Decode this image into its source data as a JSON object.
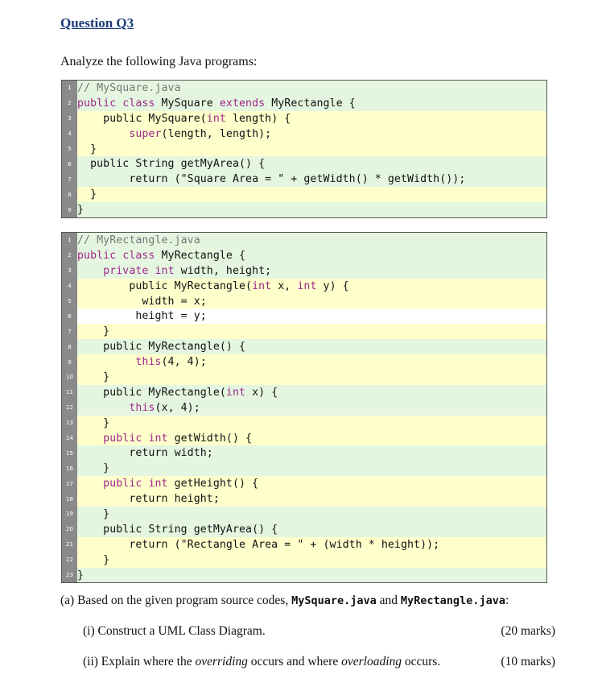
{
  "heading": "Question Q3",
  "intro": "Analyze the following Java programs:",
  "code_blocks": [
    {
      "name": "MySquare",
      "lines": [
        {
          "n": "1",
          "parts": [
            {
              "t": "// MySquare.java",
              "c": "comment"
            }
          ]
        },
        {
          "n": "2",
          "parts": [
            {
              "t": "public class ",
              "c": "kw"
            },
            {
              "t": "MySquare ",
              "c": ""
            },
            {
              "t": "extends ",
              "c": "kw"
            },
            {
              "t": "MyRectangle {",
              "c": ""
            }
          ]
        },
        {
          "n": "3",
          "parts": [
            {
              "t": "    public MySquare(",
              "c": ""
            },
            {
              "t": "int",
              "c": "kw"
            },
            {
              "t": " length) {",
              "c": ""
            }
          ]
        },
        {
          "n": "4",
          "parts": [
            {
              "t": "        super",
              "c": "kw"
            },
            {
              "t": "(length, length);",
              "c": ""
            }
          ]
        },
        {
          "n": "5",
          "parts": [
            {
              "t": "  }",
              "c": ""
            }
          ]
        },
        {
          "n": "6",
          "parts": [
            {
              "t": "  public String getMyArea() {",
              "c": ""
            }
          ]
        },
        {
          "n": "7",
          "parts": [
            {
              "t": "        return (\"Square Area = \" + getWidth() * getWidth());",
              "c": ""
            }
          ]
        },
        {
          "n": "8",
          "parts": [
            {
              "t": "  }",
              "c": ""
            }
          ]
        },
        {
          "n": "9",
          "parts": [
            {
              "t": "}",
              "c": ""
            }
          ]
        }
      ]
    },
    {
      "name": "MyRectangle",
      "lines": [
        {
          "n": "1",
          "parts": [
            {
              "t": "// MyRectangle.java",
              "c": "comment"
            }
          ]
        },
        {
          "n": "2",
          "parts": [
            {
              "t": "public class ",
              "c": "kw"
            },
            {
              "t": "MyRectangle {",
              "c": ""
            }
          ]
        },
        {
          "n": "3",
          "parts": [
            {
              "t": "    private ",
              "c": "kw"
            },
            {
              "t": "int",
              "c": "kw"
            },
            {
              "t": " width, height;",
              "c": ""
            }
          ]
        },
        {
          "n": "4",
          "parts": [
            {
              "t": "        public MyRectangle(",
              "c": ""
            },
            {
              "t": "int",
              "c": "kw"
            },
            {
              "t": " x, ",
              "c": ""
            },
            {
              "t": "int",
              "c": "kw"
            },
            {
              "t": " y) {",
              "c": ""
            }
          ]
        },
        {
          "n": "5",
          "parts": [
            {
              "t": "          width = x;",
              "c": ""
            }
          ]
        },
        {
          "n": "6",
          "parts": [
            {
              "t": "         height = y;",
              "c": ""
            }
          ]
        },
        {
          "n": "7",
          "parts": [
            {
              "t": "    }",
              "c": ""
            }
          ]
        },
        {
          "n": "8",
          "parts": [
            {
              "t": "    public MyRectangle() {",
              "c": ""
            }
          ]
        },
        {
          "n": "9",
          "parts": [
            {
              "t": "         this",
              "c": "kw"
            },
            {
              "t": "(4, 4);",
              "c": ""
            }
          ]
        },
        {
          "n": "10",
          "parts": [
            {
              "t": "    }",
              "c": ""
            }
          ]
        },
        {
          "n": "11",
          "parts": [
            {
              "t": "    public MyRectangle(",
              "c": ""
            },
            {
              "t": "int",
              "c": "kw"
            },
            {
              "t": " x) {",
              "c": ""
            }
          ]
        },
        {
          "n": "12",
          "parts": [
            {
              "t": "        this",
              "c": "kw"
            },
            {
              "t": "(x, 4);",
              "c": ""
            }
          ]
        },
        {
          "n": "13",
          "parts": [
            {
              "t": "    }",
              "c": ""
            }
          ]
        },
        {
          "n": "14",
          "parts": [
            {
              "t": "    public ",
              "c": "kw"
            },
            {
              "t": "int",
              "c": "kw"
            },
            {
              "t": " getWidth() {",
              "c": ""
            }
          ]
        },
        {
          "n": "15",
          "parts": [
            {
              "t": "        return width;",
              "c": ""
            }
          ]
        },
        {
          "n": "16",
          "parts": [
            {
              "t": "    }",
              "c": ""
            }
          ]
        },
        {
          "n": "17",
          "parts": [
            {
              "t": "    public ",
              "c": "kw"
            },
            {
              "t": "int",
              "c": "kw"
            },
            {
              "t": " getHeight() {",
              "c": ""
            }
          ]
        },
        {
          "n": "18",
          "parts": [
            {
              "t": "        return height;",
              "c": ""
            }
          ]
        },
        {
          "n": "19",
          "parts": [
            {
              "t": "    }",
              "c": ""
            }
          ]
        },
        {
          "n": "20",
          "parts": [
            {
              "t": "    public String getMyArea() {",
              "c": ""
            }
          ]
        },
        {
          "n": "21",
          "parts": [
            {
              "t": "        return (\"Rectangle Area = \" + (width * height));",
              "c": ""
            }
          ]
        },
        {
          "n": "22",
          "parts": [
            {
              "t": "    }",
              "c": ""
            }
          ]
        },
        {
          "n": "23",
          "parts": [
            {
              "t": "}",
              "c": ""
            }
          ]
        }
      ]
    }
  ],
  "part_a": {
    "prefix": "(a) Based on the given program source codes,",
    "file1": "MySquare.java",
    "and": "and",
    "file2": "MyRectangle.java",
    "suffix": ":"
  },
  "sub_i": {
    "label": "(i) Construct a UML Class Diagram.",
    "marks": "(20 marks)"
  },
  "sub_ii": {
    "pre": "(ii) Explain where the",
    "word1": "overriding",
    "mid": "occurs and where",
    "word2": "overloading",
    "post": "occurs.",
    "marks": "(10 marks)"
  }
}
